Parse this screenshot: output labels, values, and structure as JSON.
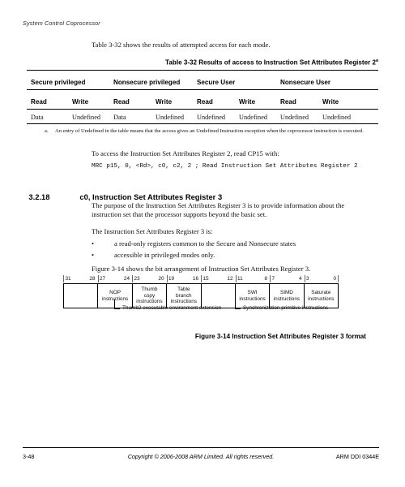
{
  "running_header": "System Control Coprocessor",
  "intro": {
    "paragraph": "Table 3-32 shows the results of attempted access for each mode."
  },
  "table": {
    "title": "Table 3-32 Results of access to Instruction Set Attributes Register 2",
    "title_footnote_marker": "a",
    "group_headers": [
      "Secure privileged",
      "Nonsecure privileged",
      "Secure User",
      "Nonsecure User"
    ],
    "sub_headers": [
      "Read",
      "Write",
      "Read",
      "Write",
      "Read",
      "Write",
      "Read",
      "Write"
    ],
    "rows": [
      [
        "Data",
        "Undefined",
        "Data",
        "Undefined",
        "Undefined",
        "Undefined",
        "Undefined",
        "Undefined"
      ]
    ],
    "footnote": {
      "marker": "a.",
      "text": "An entry of Undefined in the table means that the access gives an Undefined Instruction exception when the coprocessor instruction is executed."
    }
  },
  "access": {
    "lead_in": "To access the Instruction Set Attributes Register 2, read CP15 with:",
    "code": "MRC p15, 0, <Rd>, c0, c2, 2 ; Read Instruction Set Attributes Register 2"
  },
  "section": {
    "number": "3.2.18",
    "title": "c0, Instruction Set Attributes Register 3",
    "purpose": "The purpose of the Instruction Set Attributes Register 3 is to provide information about the instruction set that the processor supports beyond the basic set.",
    "list_lead_in": "The Instruction Set Attributes Register 3 is:",
    "bullets": [
      "a read-only registers common to the Secure and Nonsecure states",
      "accessible in privileged modes only."
    ],
    "figure_lead_in": "Figure 3-14 shows the bit arrangement of Instruction Set Attributes Register 3."
  },
  "register_diagram": {
    "bit_ranges": [
      {
        "hi": "31",
        "lo": "28"
      },
      {
        "hi": "27",
        "lo": "24"
      },
      {
        "hi": "23",
        "lo": "20"
      },
      {
        "hi": "19",
        "lo": "16"
      },
      {
        "hi": "15",
        "lo": "12"
      },
      {
        "hi": "11",
        "lo": "8"
      },
      {
        "hi": "7",
        "lo": "4"
      },
      {
        "hi": "3",
        "lo": "0"
      }
    ],
    "fields": [
      {
        "line1": "",
        "line2": "",
        "line3": ""
      },
      {
        "line1": "NOP",
        "line2": "instructions",
        "line3": ""
      },
      {
        "line1": "Thumb",
        "line2": "copy",
        "line3": "instructions"
      },
      {
        "line1": "Table",
        "line2": "branch",
        "line3": "instructions"
      },
      {
        "line1": "",
        "line2": "",
        "line3": ""
      },
      {
        "line1": "SWI",
        "line2": "instructions",
        "line3": ""
      },
      {
        "line1": "SIMD",
        "line2": "instructions",
        "line3": ""
      },
      {
        "line1": "Saturate",
        "line2": "instructions",
        "line3": ""
      }
    ],
    "callouts": [
      "Thumb2 executable environment extension",
      "Synchronization primitive instructions"
    ],
    "caption": "Figure 3-14 Instruction Set Attributes Register 3 format"
  },
  "footer": {
    "page_number": "3-48",
    "copyright": "Copyright © 2006-2008 ARM Limited. All rights reserved.",
    "doc_id": "ARM DDI 0344E"
  }
}
